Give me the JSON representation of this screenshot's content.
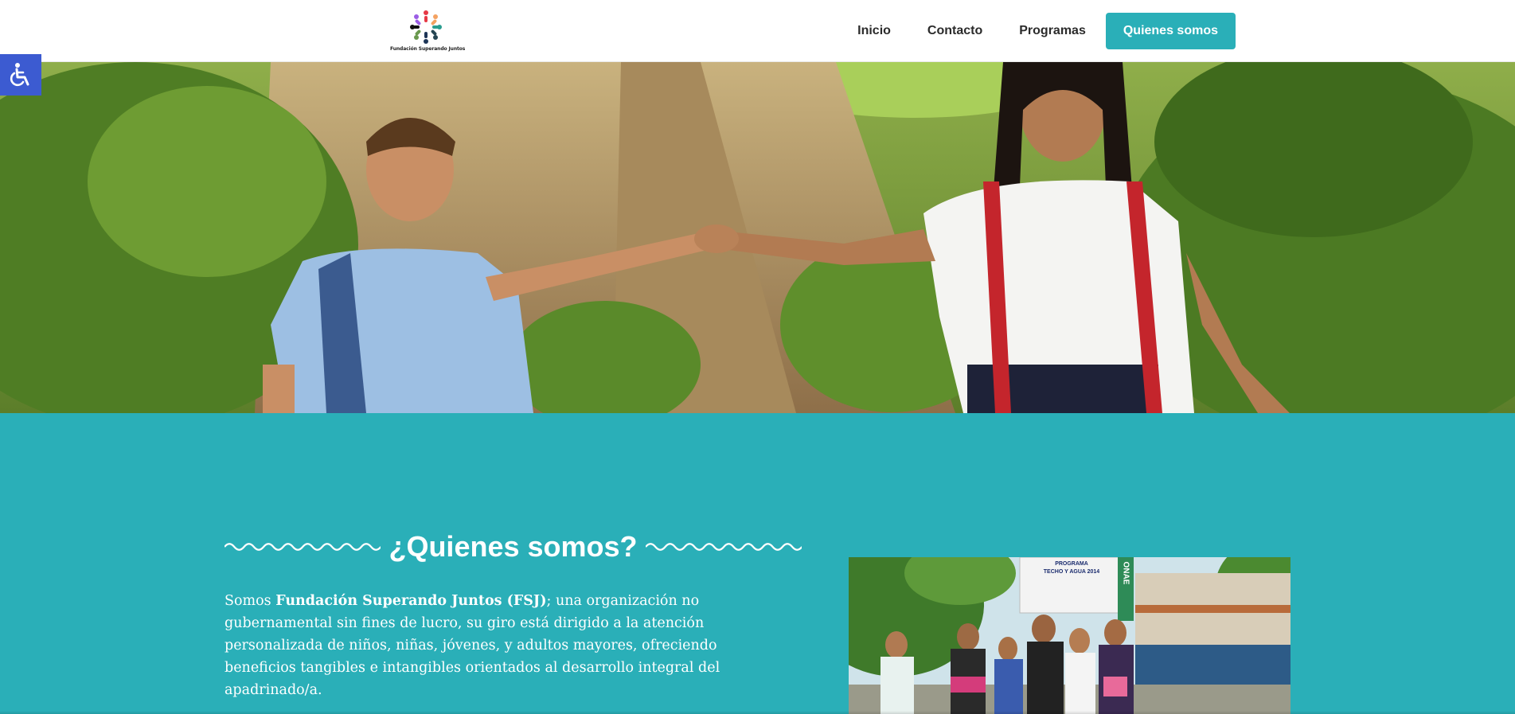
{
  "header": {
    "logo_text": "Fundación Superando Juntos",
    "nav": [
      "Inicio",
      "Contacto",
      "Programas",
      "Quienes somos"
    ],
    "active_nav": "Quienes somos"
  },
  "accessibility": {
    "icon": "wheelchair-icon"
  },
  "hero": {
    "image": "children-holding-hands-on-rural-path"
  },
  "about": {
    "title": "¿Quienes somos?",
    "intro_prefix": "Somos ",
    "org_name": "Fundación Superando Juntos (FSJ)",
    "intro_rest": "; una organización no gubernamental sin fines de lucro, su giro está dirigido a la atención personalizada de niños, niñas, jóvenes, y adultos mayores, ofreciendo beneficios tangibles e intangibles orientados al desarrollo integral del apadrinado/a.",
    "photo": "group-of-schoolgirls-photo",
    "sign": {
      "line1": "PROGRAMA",
      "line2": "TECHO Y AGUA 2014",
      "vertical": "ONAE"
    }
  },
  "colors": {
    "teal": "#2aafb8",
    "accessibility_blue": "#3c5bd1",
    "nav_text": "#2b2b2b"
  }
}
